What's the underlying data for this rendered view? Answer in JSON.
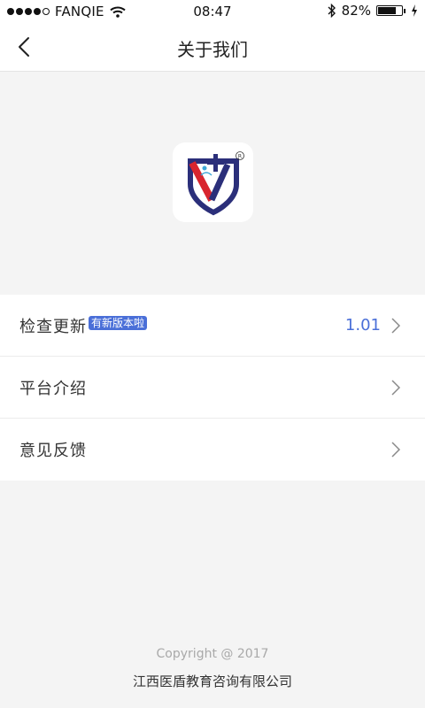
{
  "status_bar": {
    "carrier": "FANQIE",
    "time": "08:47",
    "battery_percent": "82%",
    "battery_level": 0.82,
    "signal_bars": 4
  },
  "nav": {
    "title": "关于我们",
    "back_icon": "chevron-left-icon"
  },
  "menu": {
    "items": [
      {
        "label": "检查更新",
        "badge": "有新版本啦",
        "value": "1.01"
      },
      {
        "label": "平台介绍"
      },
      {
        "label": "意见反馈"
      }
    ]
  },
  "footer": {
    "copyright": "Copyright @ 2017",
    "company": "江西医盾教育咨询有限公司"
  },
  "colors": {
    "accent": "#4a6fd8",
    "logo_navy": "#2b2f7a",
    "logo_red": "#d8252e",
    "background": "#f4f4f4"
  }
}
